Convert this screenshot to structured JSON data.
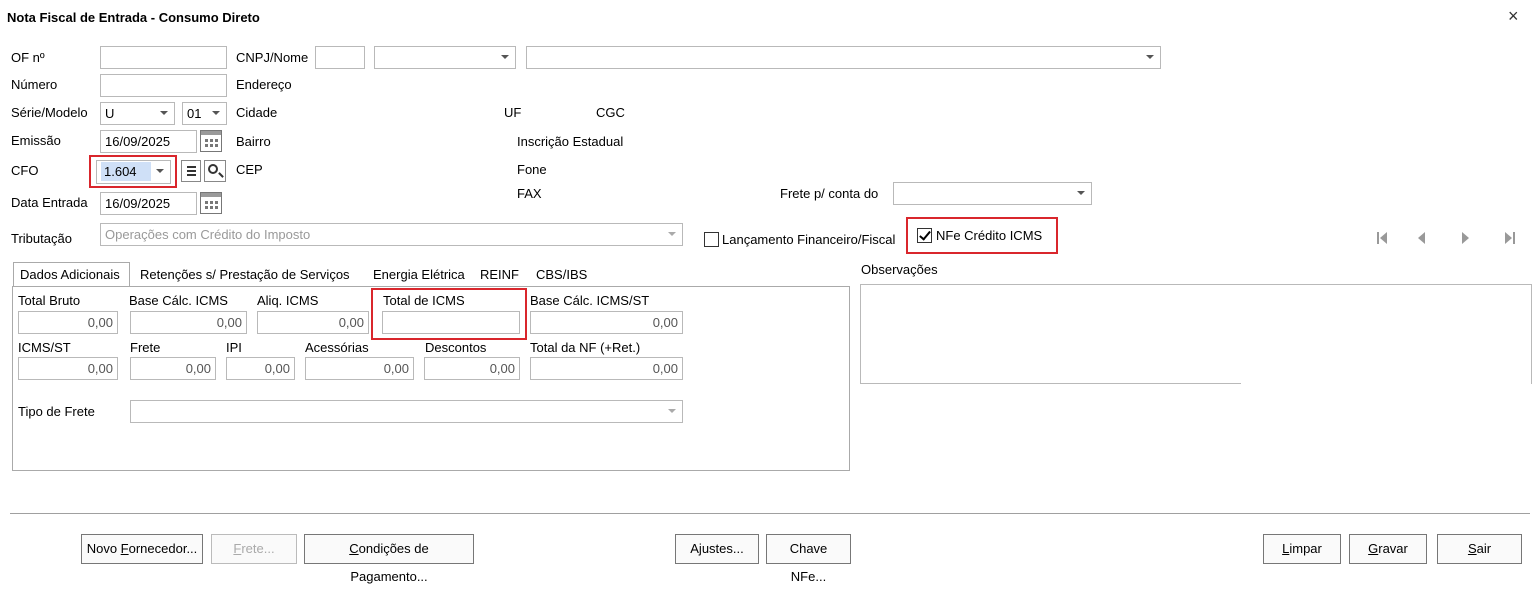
{
  "window": {
    "title": "Nota Fiscal de Entrada - Consumo Direto",
    "close_symbol": "×"
  },
  "labels": {
    "of": "OF nº",
    "numero": "Número",
    "serie_modelo": "Série/Modelo",
    "emissao": "Emissão",
    "cfo": "CFO",
    "data_entrada": "Data Entrada",
    "cnpj_nome": "CNPJ/Nome",
    "endereco": "Endereço",
    "cidade": "Cidade",
    "bairro": "Bairro",
    "cep": "CEP",
    "uf": "UF",
    "cgc": "CGC",
    "inscricao": "Inscrição Estadual",
    "fone": "Fone",
    "fax": "FAX",
    "frete_conta": "Frete p/ conta do",
    "tributacao": "Tributação"
  },
  "fields": {
    "serie": "U",
    "modelo": "01",
    "emissao": "16/09/2025",
    "cfo": "1.604",
    "data_entrada": "16/09/2025",
    "tributacao": "Operações com Crédito do Imposto"
  },
  "checkboxes": {
    "lancamento": {
      "label": "Lançamento Financeiro/Fiscal",
      "checked": false
    },
    "nfe_credito": {
      "label": "NFe Crédito ICMS",
      "checked": true
    }
  },
  "tabs": [
    "Dados Adicionais",
    "Retenções s/ Prestação de Serviços",
    "Energia Elétrica",
    "REINF",
    "CBS/IBS"
  ],
  "totals": {
    "total_bruto": {
      "label": "Total Bruto",
      "value": "0,00"
    },
    "base_icms": {
      "label": "Base Cálc. ICMS",
      "value": "0,00"
    },
    "aliq_icms": {
      "label": "Aliq. ICMS",
      "value": "0,00"
    },
    "total_icms": {
      "label": "Total de ICMS",
      "value": ""
    },
    "base_icms_st": {
      "label": "Base Cálc. ICMS/ST",
      "value": "0,00"
    },
    "icms_st": {
      "label": "ICMS/ST",
      "value": "0,00"
    },
    "frete": {
      "label": "Frete",
      "value": "0,00"
    },
    "ipi": {
      "label": "IPI",
      "value": "0,00"
    },
    "acessorias": {
      "label": "Acessórias",
      "value": "0,00"
    },
    "descontos": {
      "label": "Descontos",
      "value": "0,00"
    },
    "total_nf": {
      "label": "Total da NF (+Ret.)",
      "value": "0,00"
    },
    "tipo_frete": {
      "label": "Tipo de Frete"
    }
  },
  "observacoes": {
    "label": "Observações"
  },
  "buttons": {
    "novo_fornecedor": {
      "pre": "Novo ",
      "key": "F",
      "post": "ornecedor..."
    },
    "frete": {
      "pre": "",
      "key": "F",
      "post": "rete..."
    },
    "condicoes": {
      "pre": "",
      "key": "C",
      "post": "ondições de Pagamento..."
    },
    "ajustes": {
      "pre": "Ajustes...",
      "key": "",
      "post": ""
    },
    "chave_nfe": {
      "pre": "Chave NFe...",
      "key": "",
      "post": ""
    },
    "limpar": {
      "pre": "",
      "key": "L",
      "post": "impar"
    },
    "gravar": {
      "pre": "",
      "key": "G",
      "post": "ravar"
    },
    "sair": {
      "pre": "",
      "key": "S",
      "post": "air"
    }
  },
  "colors": {
    "highlight": "#d9262c",
    "selected_value_bg": "#cfe0f7"
  }
}
